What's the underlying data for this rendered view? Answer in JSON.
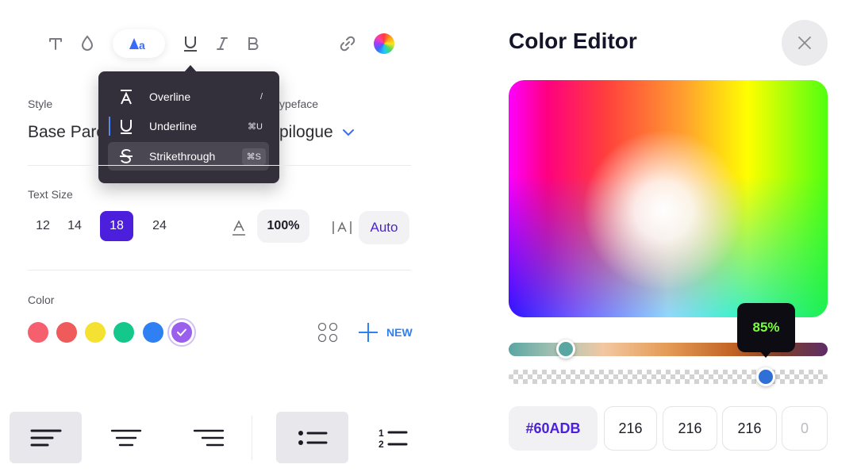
{
  "toolbar": {
    "tools": [
      {
        "name": "text-tool",
        "icon": "text-icon"
      },
      {
        "name": "fill-tool",
        "icon": "droplet-icon"
      },
      {
        "name": "font-style-tool",
        "icon": "font-style-icon",
        "label": "Aa",
        "active": true
      },
      {
        "name": "underline-tool",
        "icon": "underline-icon"
      },
      {
        "name": "italic-tool",
        "icon": "italic-icon"
      },
      {
        "name": "bold-tool",
        "icon": "bold-icon"
      },
      {
        "name": "link-tool",
        "icon": "link-icon"
      },
      {
        "name": "color-wheel-tool",
        "icon": "color-wheel-icon"
      }
    ]
  },
  "decoration_menu": {
    "items": [
      {
        "label": "Overline",
        "shortcut": "/",
        "icon": "overline-icon"
      },
      {
        "label": "Underline",
        "shortcut": "⌘U",
        "icon": "underline-icon"
      },
      {
        "label": "Strikethrough",
        "shortcut": "⌘S",
        "icon": "strikethrough-icon",
        "selected": true
      }
    ]
  },
  "style": {
    "label": "Style",
    "value": "Base Parc",
    "typeface_label": "ypeface",
    "typeface_value": "pilogue"
  },
  "text_size": {
    "label": "Text Size",
    "options": [
      "12",
      "14",
      "18",
      "24"
    ],
    "selected": "18",
    "letter_spacing": "100%",
    "line_height": "Auto"
  },
  "color": {
    "label": "Color",
    "swatches": [
      "#f55f6e",
      "#ef5a5a",
      "#f5e132",
      "#14c88c",
      "#2f80f2",
      "#9a5fec"
    ],
    "selected_index": 5,
    "new_label": "NEW",
    "accent": "#2f80f2"
  },
  "alignment": {
    "items": [
      "align-left",
      "align-center",
      "align-right",
      "bullet-list",
      "numbered-list"
    ],
    "selected": [
      "align-left",
      "bullet-list"
    ]
  },
  "color_editor": {
    "title": "Color Editor",
    "opacity_tooltip": "85%",
    "hue_position": 0.18,
    "opacity_position": 0.807,
    "hex": "#60ADB",
    "r": "216",
    "g": "216",
    "b": "216",
    "a": "0"
  }
}
